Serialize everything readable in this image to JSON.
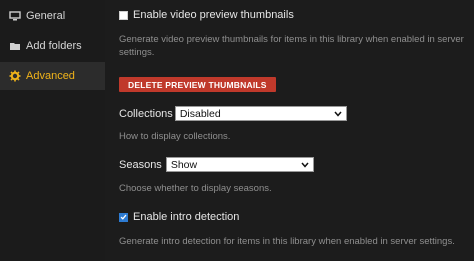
{
  "sidebar": {
    "items": [
      {
        "label": "General",
        "icon": "monitor-icon"
      },
      {
        "label": "Add folders",
        "icon": "folder-icon"
      },
      {
        "label": "Advanced",
        "icon": "gear-icon"
      }
    ],
    "active_color": "#f0b31a"
  },
  "settings": {
    "video_preview": {
      "label": "Enable video preview thumbnails",
      "checked": false,
      "description": "Generate video preview thumbnails for items in this library when enabled in server settings."
    },
    "delete_button_label": "DELETE PREVIEW THUMBNAILS",
    "collections": {
      "label": "Collections",
      "value": "Disabled",
      "description": "How to display collections."
    },
    "seasons": {
      "label": "Seasons",
      "value": "Show",
      "description": "Choose whether to display seasons."
    },
    "intro_detection": {
      "label": "Enable intro detection",
      "checked": true,
      "description": "Generate intro detection for items in this library when enabled in server settings."
    }
  },
  "colors": {
    "danger": "#c0392b",
    "checkbox_checked": "#2d7bd1"
  }
}
